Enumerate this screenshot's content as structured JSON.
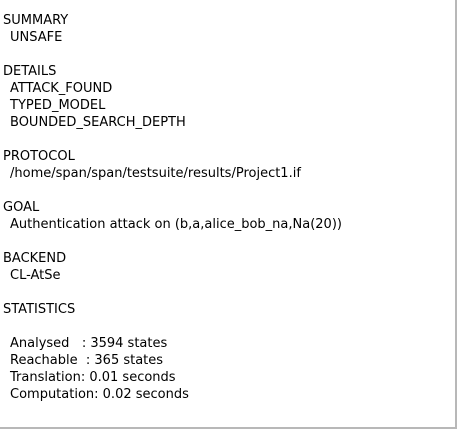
{
  "summary": {
    "heading": "SUMMARY",
    "value": "UNSAFE"
  },
  "details": {
    "heading": "DETAILS",
    "items": [
      "ATTACK_FOUND",
      "TYPED_MODEL",
      "BOUNDED_SEARCH_DEPTH"
    ]
  },
  "protocol": {
    "heading": "PROTOCOL",
    "value": "/home/span/span/testsuite/results/Project1.if"
  },
  "goal": {
    "heading": "GOAL",
    "value": "Authentication attack on (b,a,alice_bob_na,Na(20))"
  },
  "backend": {
    "heading": "BACKEND",
    "value": "CL-AtSe"
  },
  "statistics": {
    "heading": "STATISTICS",
    "analysed": "Analysed   : 3594 states",
    "reachable": "Reachable  : 365 states",
    "translation": "Translation: 0.01 seconds",
    "computation": "Computation: 0.02 seconds"
  }
}
